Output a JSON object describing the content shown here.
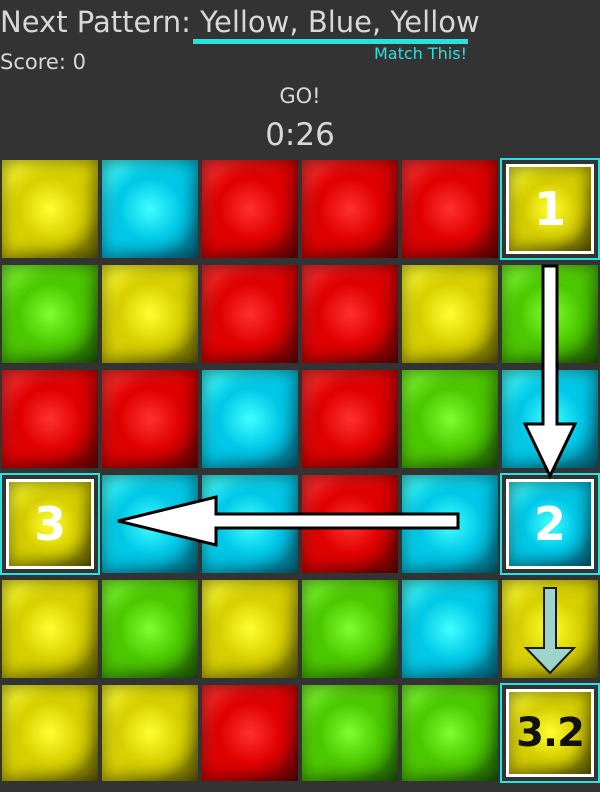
{
  "header": {
    "prefix": "Next Pattern: ",
    "pattern": "Yellow, Blue, Yellow",
    "hint": "Match This!"
  },
  "score_label": "Score: 0",
  "status": "GO!",
  "timer": "0:26",
  "colors": {
    "yellow": "#d8d000",
    "blue": "#00c8e8",
    "red": "#e80000",
    "green": "#50d000",
    "accent": "#25e3e0"
  },
  "board": {
    "rows": [
      [
        "yellow",
        "blue",
        "red",
        "red",
        "red",
        "yellow"
      ],
      [
        "green",
        "yellow",
        "red",
        "red",
        "yellow",
        "green"
      ],
      [
        "red",
        "red",
        "blue",
        "red",
        "green",
        "blue"
      ],
      [
        "yellow",
        "blue",
        "blue",
        "red",
        "blue",
        "blue"
      ],
      [
        "yellow",
        "green",
        "yellow",
        "green",
        "blue",
        "yellow"
      ],
      [
        "yellow",
        "yellow",
        "red",
        "green",
        "green",
        "yellow"
      ]
    ],
    "markers": [
      {
        "row": 0,
        "col": 5,
        "label": "1",
        "dark": false
      },
      {
        "row": 3,
        "col": 5,
        "label": "2",
        "dark": false
      },
      {
        "row": 3,
        "col": 0,
        "label": "3",
        "dark": false
      },
      {
        "row": 5,
        "col": 5,
        "label": "3.2",
        "dark": true
      }
    ]
  },
  "arrows": [
    {
      "name": "arrow-down-1-to-2-icon"
    },
    {
      "name": "arrow-left-2-to-3-icon"
    },
    {
      "name": "arrow-down-2-to-3-2-icon"
    }
  ]
}
